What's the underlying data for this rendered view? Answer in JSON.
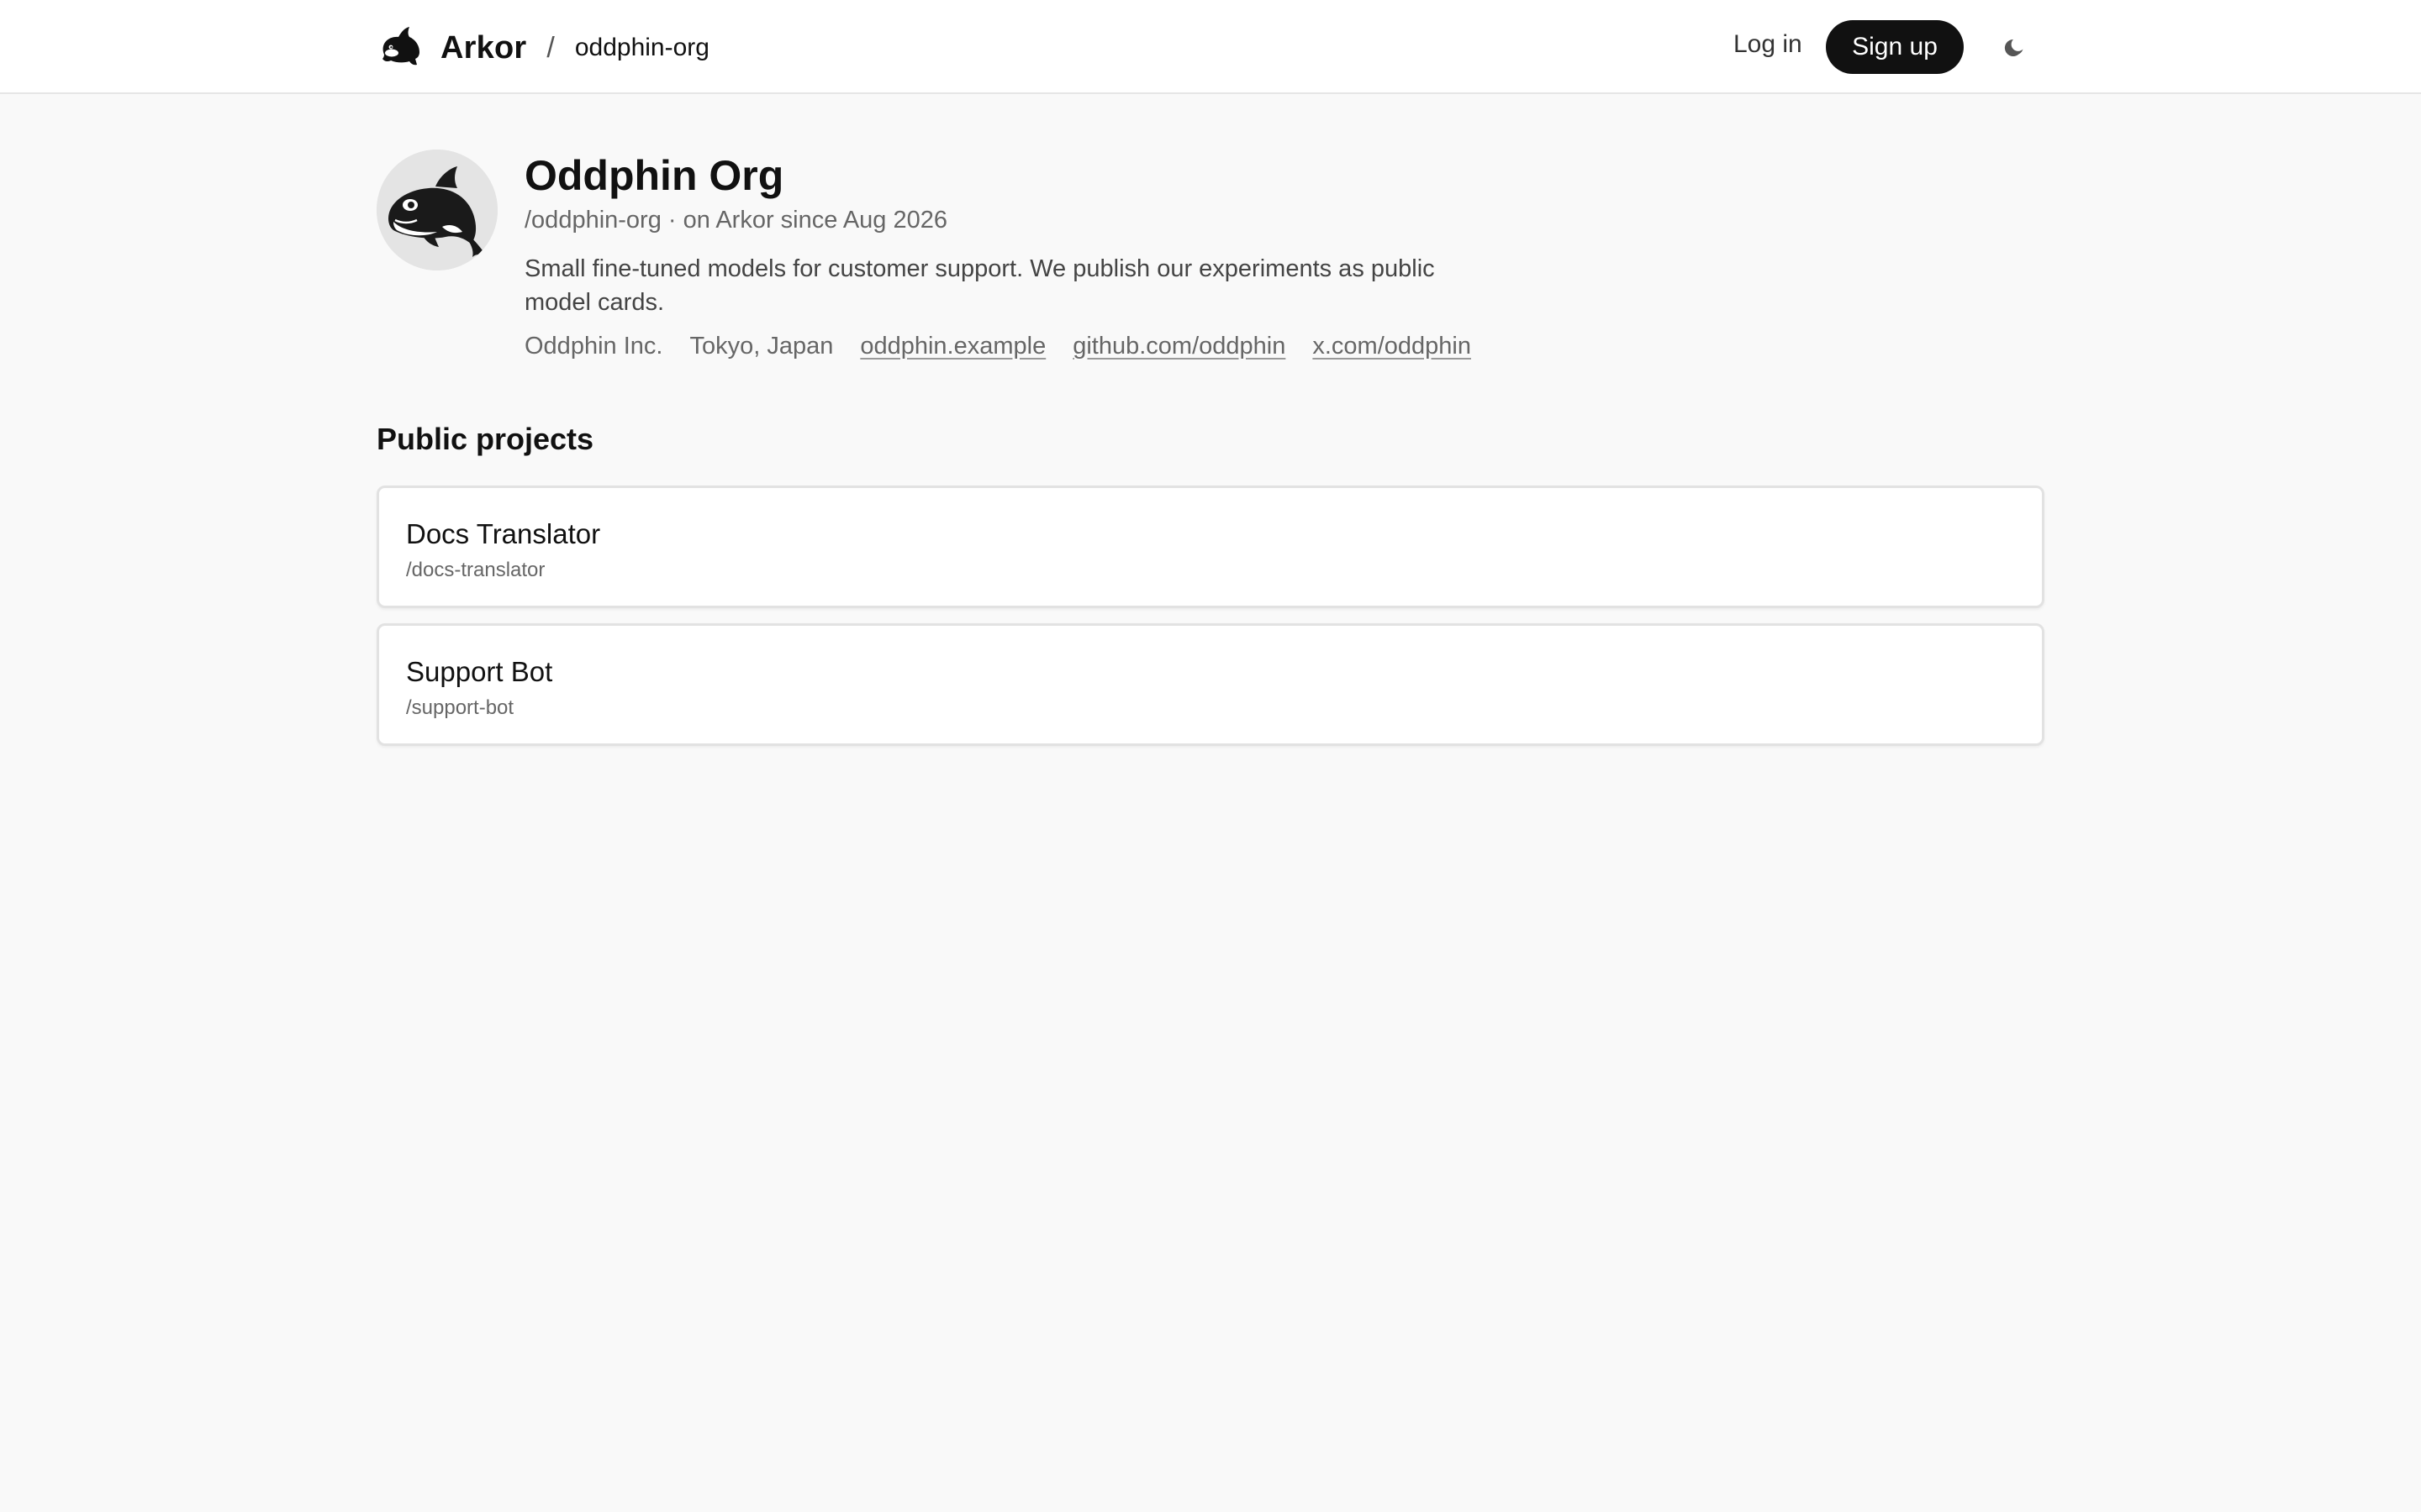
{
  "header": {
    "brand_name": "Arkor",
    "breadcrumb_separator": "/",
    "breadcrumb_org": "oddphin-org",
    "login_label": "Log in",
    "signup_label": "Sign up",
    "theme_icon": "moon-icon"
  },
  "org": {
    "title": "Oddphin Org",
    "meta": "/oddphin-org · on Arkor since Aug 2026",
    "description": "Small fine-tuned models for customer support. We publish our experiments as public model cards.",
    "company": "Oddphin Inc.",
    "location": "Tokyo, Japan",
    "links": [
      "oddphin.example",
      "github.com/oddphin",
      "x.com/oddphin"
    ]
  },
  "projects": {
    "title": "Public projects",
    "items": [
      {
        "name": "Docs Translator",
        "slug": "/docs-translator"
      },
      {
        "name": "Support Bot",
        "slug": "/support-bot"
      }
    ]
  },
  "colors": {
    "page_background": "#f9f9f9",
    "primary_button": "#111111",
    "card_border": "#e2e2e2"
  }
}
